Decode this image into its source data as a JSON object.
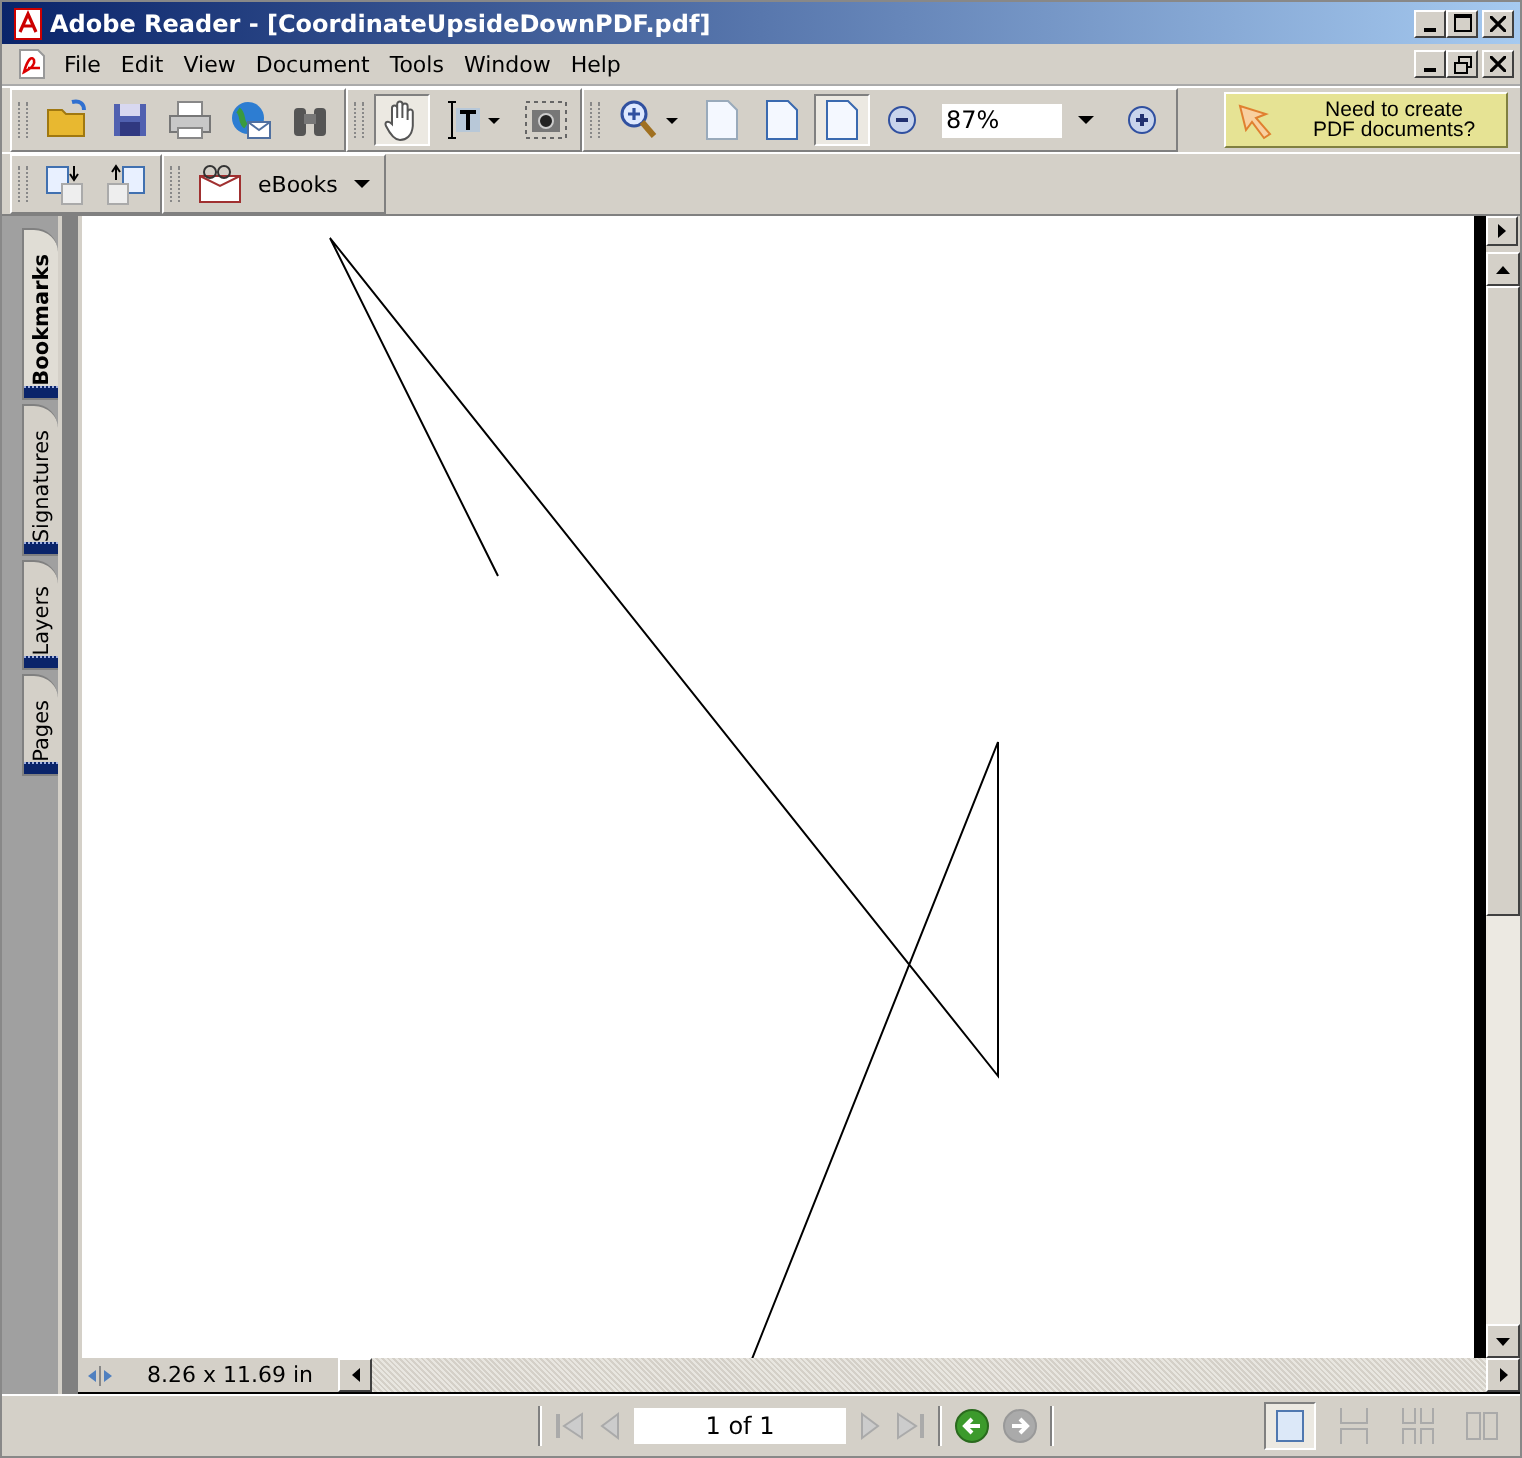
{
  "window": {
    "title": "Adobe Reader - [CoordinateUpsideDownPDF.pdf]"
  },
  "menu": [
    "File",
    "Edit",
    "View",
    "Document",
    "Tools",
    "Window",
    "Help"
  ],
  "tools": [
    {
      "kind": "hand",
      "selected": true
    },
    {
      "kind": "select-text",
      "selected": false
    },
    {
      "kind": "snapshot",
      "selected": false
    }
  ],
  "page_views": [
    {
      "kind": "actual-size",
      "selected": false
    },
    {
      "kind": "fit-page",
      "selected": false
    },
    {
      "kind": "fit-width",
      "selected": true
    }
  ],
  "zoom": {
    "value": "87%"
  },
  "promo": {
    "lines": [
      "Need to create",
      "PDF documents?"
    ]
  },
  "ebooks": {
    "label": "eBooks"
  },
  "side_tabs": [
    {
      "label": "Bookmarks",
      "selected": true
    },
    {
      "label": "Signatures",
      "selected": false
    },
    {
      "label": "Layers",
      "selected": false
    },
    {
      "label": "Pages",
      "selected": false
    }
  ],
  "page_size": "8.26 x 11.69 in",
  "page_field": {
    "value": "1 of 1"
  },
  "layouts": [
    {
      "kind": "single",
      "selected": true
    },
    {
      "kind": "continuous",
      "selected": false
    },
    {
      "kind": "continuous-facing",
      "selected": false
    },
    {
      "kind": "facing",
      "selected": false
    }
  ]
}
